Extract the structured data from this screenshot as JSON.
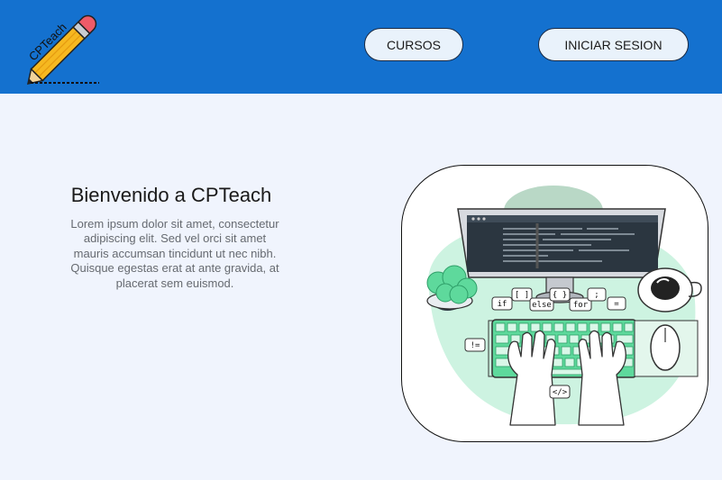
{
  "header": {
    "logo_text": "CPTeach",
    "nav": {
      "courses_label": "CURSOS",
      "login_label": "INICIAR SESION"
    }
  },
  "hero": {
    "title": "Bienvenido a CPTeach",
    "description": "Lorem ipsum dolor sit amet, consectetur adipiscing elit. Sed vel orci sit amet mauris accumsan tincidunt ut nec nibh. Quisque egestas erat at ante gravida, at placerat sem euismod."
  },
  "illustration": {
    "bubbles": [
      "if",
      "[ ]",
      "else",
      "{ }",
      "for",
      ";",
      "=",
      "!=",
      "</>"
    ]
  },
  "colors": {
    "header": "#1471cf",
    "page_background": "#f0f4fd",
    "button_fill": "#e9f2fb",
    "accent_green": "#5ed99c",
    "mint": "#cdf3e1"
  }
}
